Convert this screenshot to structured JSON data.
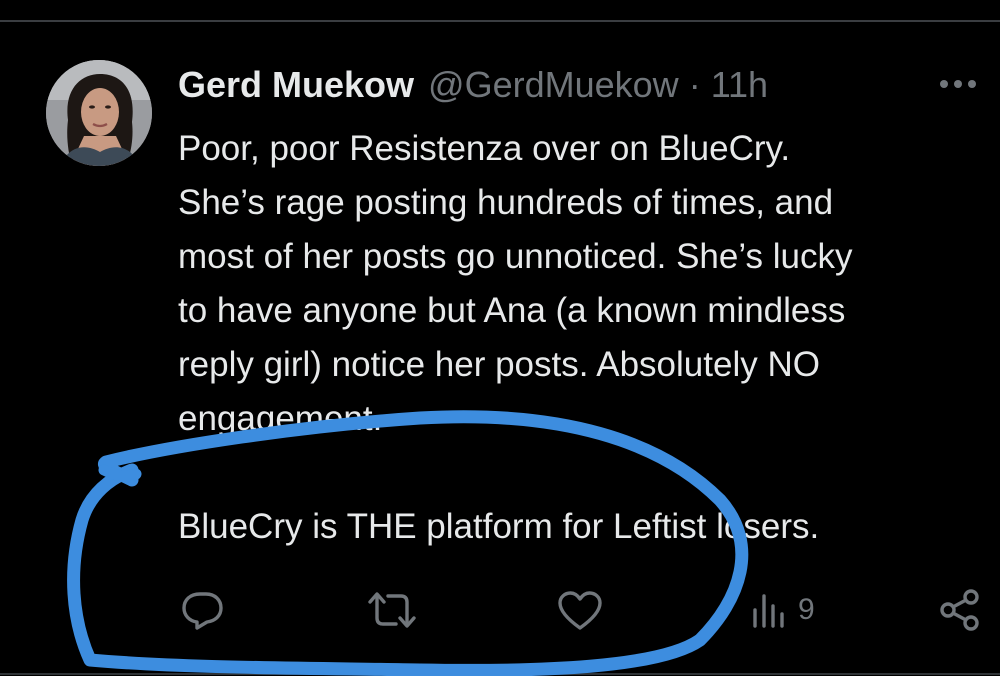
{
  "post": {
    "author": {
      "display_name": "Gerd Muekow",
      "handle": "@GerdMuekow",
      "separator": "·",
      "time": "11h"
    },
    "text_lines": [
      "Poor, poor Resistenza over on BlueCry.",
      "She’s rage posting hundreds of times, and",
      "most of her posts go unnoticed.  She’s lucky",
      "to have anyone but Ana (a known mindless",
      "reply girl) notice her posts.  Absolutely NO",
      "engagement.",
      "",
      "BlueCry is THE platform for Leftist losers."
    ],
    "actions": {
      "reply_icon": "reply-icon",
      "repost_icon": "repost-icon",
      "like_icon": "heart-icon",
      "views_icon": "bar-chart-icon",
      "views_count": "9",
      "share_icon": "share-icon"
    }
  },
  "annotation": {
    "shape": "hand-drawn-circle",
    "color": "#3d8ddf"
  },
  "colors": {
    "background": "#000000",
    "text_primary": "#e7e9ea",
    "text_secondary": "#71767b"
  }
}
